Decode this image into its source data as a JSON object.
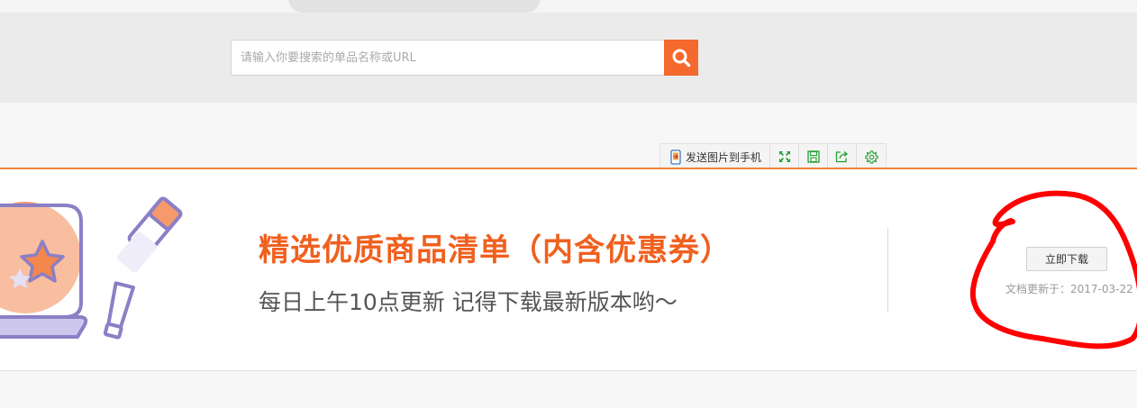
{
  "search": {
    "placeholder": "请输入你要搜索的单品名称或URL"
  },
  "toolbar": {
    "send_label": "发送图片到手机",
    "icons": [
      "phone-send-icon",
      "fullscreen-icon",
      "save-icon",
      "share-icon",
      "settings-icon"
    ]
  },
  "banner": {
    "headline": "精选优质商品清单（内含优惠券）",
    "subline": "每日上午10点更新  记得下载最新版本哟～",
    "download_label": "立即下载",
    "update_text": "文档更新于：2017-03-22"
  },
  "colors": {
    "accent": "#f4692d",
    "headline": "#f0601e",
    "toolbar_icon": "#22a033",
    "annotation": "#ff0000"
  }
}
